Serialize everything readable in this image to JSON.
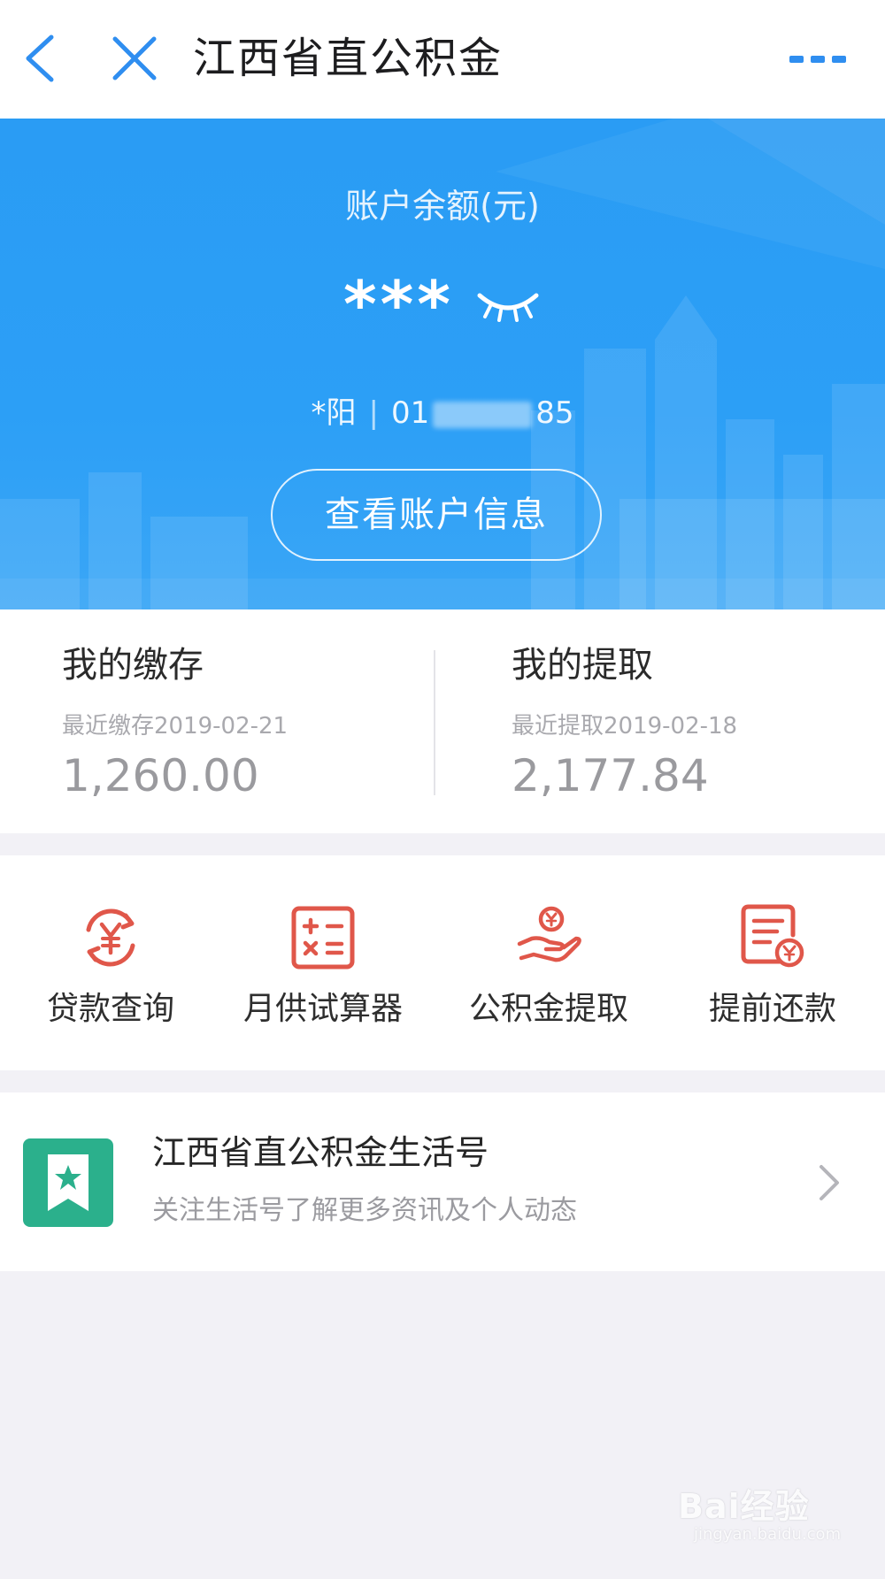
{
  "header": {
    "title": "江西省直公积金",
    "icons": {
      "back": "chevron-left-icon",
      "close": "close-icon",
      "more": "more-dots-icon"
    },
    "accent": "#2f8ef0"
  },
  "hero": {
    "balance_label": "账户余额(元)",
    "balance_masked": "***",
    "eye_icon": "eye-closed-icon",
    "account_name": "*阳",
    "separator": "|",
    "account_prefix": "01",
    "account_suffix": "85",
    "view_button": "查看账户信息",
    "bg_color": "#2c9ff6"
  },
  "summary": {
    "deposit": {
      "title": "我的缴存",
      "subtitle": "最近缴存2019-02-21",
      "amount": "1,260.00"
    },
    "withdraw": {
      "title": "我的提取",
      "subtitle": "最近提取2019-02-18",
      "amount": "2,177.84"
    }
  },
  "shortcuts": [
    {
      "label": "贷款查询",
      "icon": "yen-refresh-icon"
    },
    {
      "label": "月供试算器",
      "icon": "calculator-icon"
    },
    {
      "label": "公积金提取",
      "icon": "hand-coin-icon"
    },
    {
      "label": "提前还款",
      "icon": "receipt-yen-icon"
    }
  ],
  "shortcut_color": "#e0574a",
  "life_account": {
    "title": "江西省直公积金生活号",
    "subtitle": "关注生活号了解更多资讯及个人动态",
    "logo_icon": "bookmark-star-icon",
    "logo_color": "#2bb08c"
  },
  "watermark": {
    "main": "Bai经验",
    "sub": "jingyan.baidu.com"
  }
}
